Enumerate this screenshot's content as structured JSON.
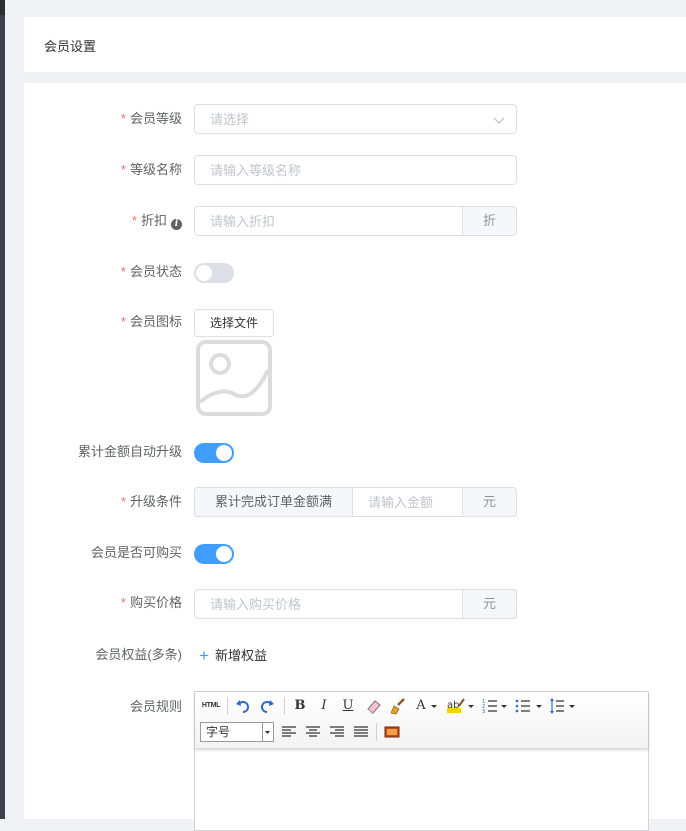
{
  "header": {
    "title": "会员设置"
  },
  "form": {
    "level": {
      "label": "会员等级",
      "placeholder": "请选择"
    },
    "level_name": {
      "label": "等级名称",
      "placeholder": "请输入等级名称"
    },
    "discount": {
      "label": "折扣",
      "placeholder": "请输入折扣",
      "suffix": "折"
    },
    "status": {
      "label": "会员状态",
      "enabled": false
    },
    "icon": {
      "label": "会员图标",
      "button": "选择文件"
    },
    "auto_upgrade": {
      "label": "累计金额自动升级",
      "enabled": true
    },
    "upgrade_condition": {
      "label": "升级条件",
      "prefix": "累计完成订单金额满",
      "placeholder": "请输入金额",
      "suffix": "元"
    },
    "purchasable": {
      "label": "会员是否可购买",
      "enabled": true
    },
    "price": {
      "label": "购买价格",
      "placeholder": "请输入购买价格",
      "suffix": "元"
    },
    "benefits": {
      "label": "会员权益(多条)",
      "add_button": "新增权益"
    },
    "rules": {
      "label": "会员规则",
      "font_size_select": "字号"
    }
  },
  "colors": {
    "primary": "#409eff",
    "required": "#f56c6c",
    "switch_off": "#dcdfe6"
  },
  "icons": {
    "editor_toolbar": [
      "html-source-icon",
      "undo-icon",
      "redo-icon",
      "bold-icon",
      "italic-icon",
      "underline-icon",
      "eraser-icon",
      "format-painter-icon",
      "font-color-icon",
      "highlight-icon",
      "ordered-list-icon",
      "unordered-list-icon",
      "line-height-icon",
      "align-left-icon",
      "align-center-icon",
      "align-right-icon",
      "align-justify-icon",
      "insert-image-icon"
    ]
  }
}
